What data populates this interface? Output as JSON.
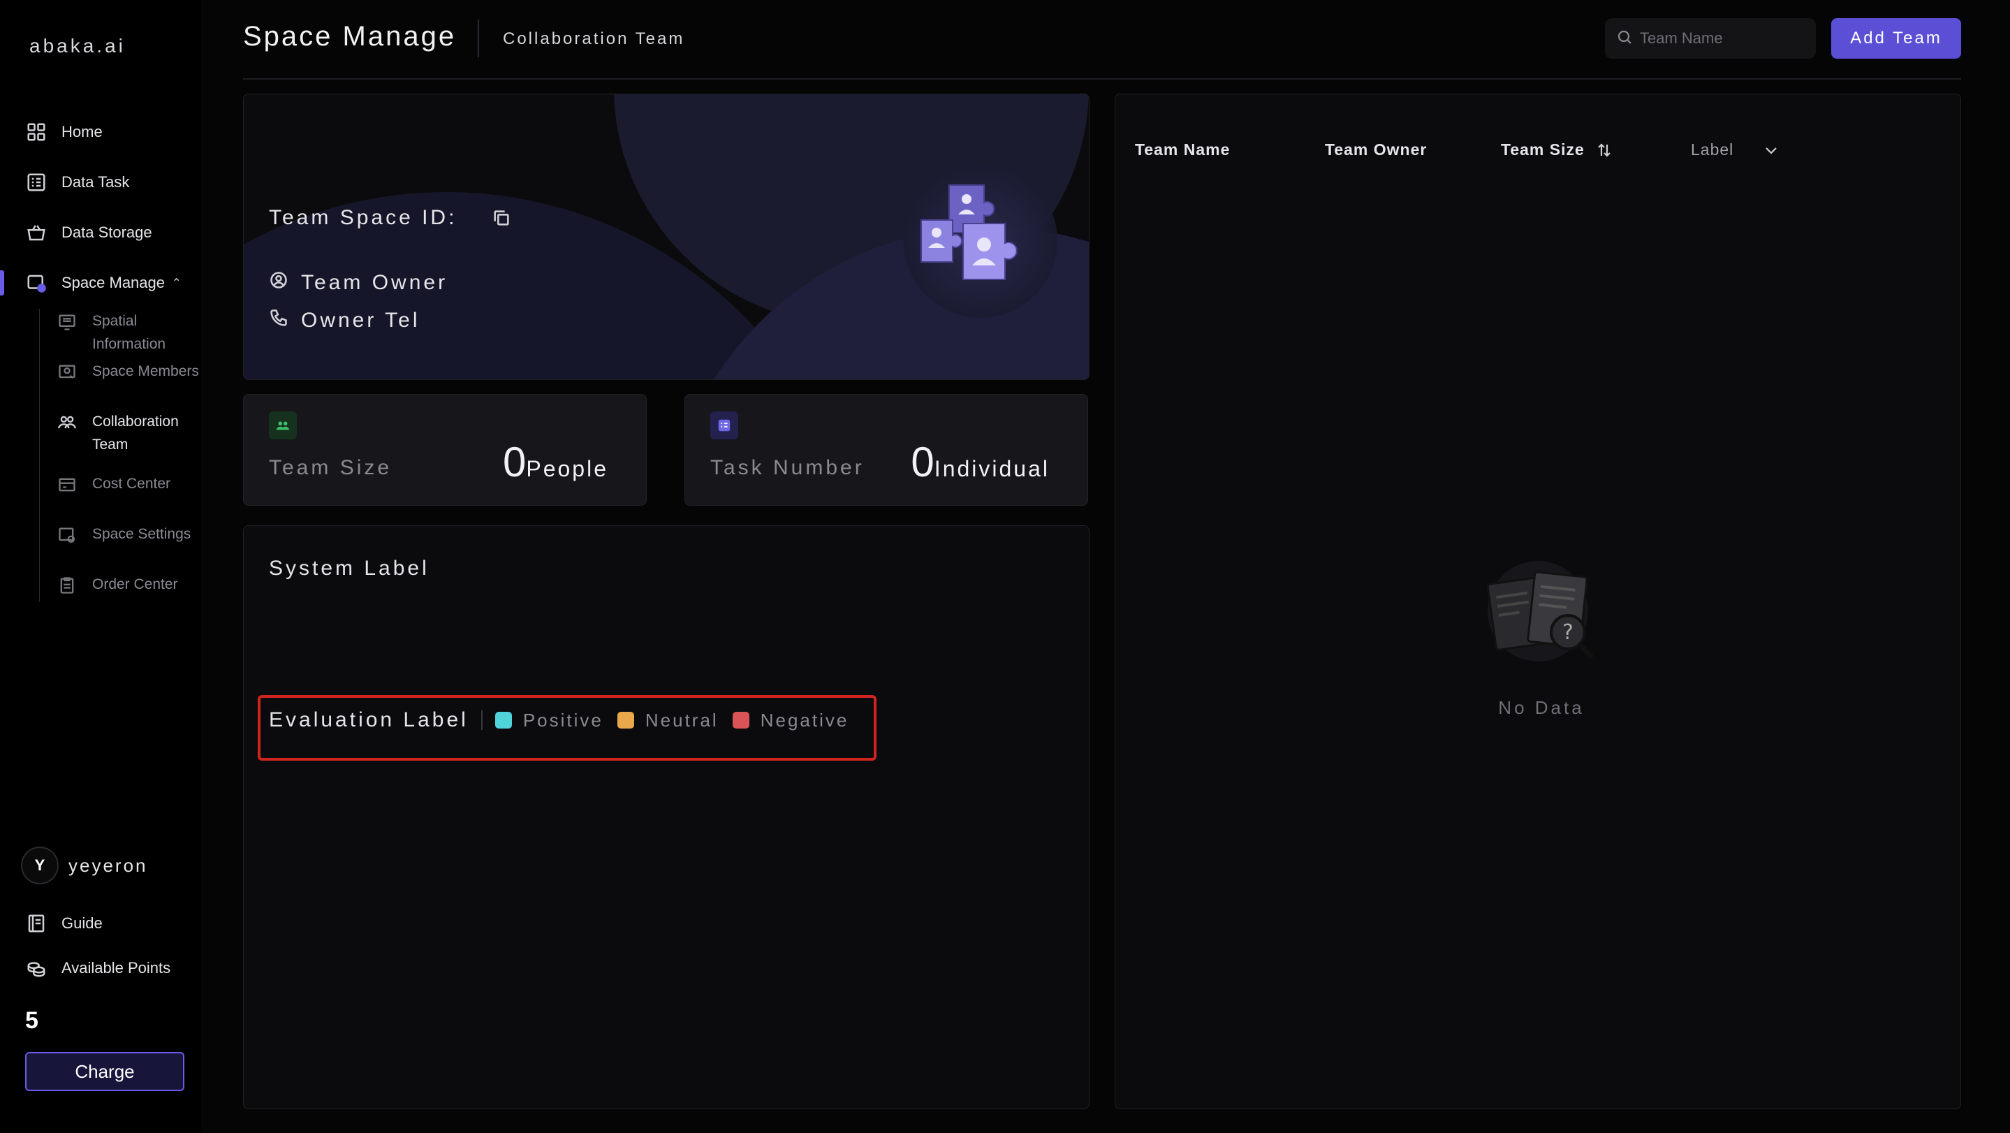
{
  "brand": {
    "logo": "abaka.ai"
  },
  "sidebar": {
    "items": [
      {
        "label": "Home"
      },
      {
        "label": "Data Task"
      },
      {
        "label": "Data Storage"
      },
      {
        "label": "Space Manage"
      }
    ],
    "sub_items": [
      {
        "label": "Spatial Information"
      },
      {
        "label": "Space Members"
      },
      {
        "label": "Collaboration Team"
      },
      {
        "label": "Cost Center"
      },
      {
        "label": "Space Settings"
      },
      {
        "label": "Order Center"
      }
    ],
    "user": {
      "initial": "Y",
      "name": "yeyeron"
    },
    "guide": "Guide",
    "points_label": "Available Points",
    "points_value": "5",
    "charge": "Charge"
  },
  "header": {
    "title": "Space Manage",
    "subtitle": "Collaboration Team",
    "search_placeholder": "Team Name",
    "add_button": "Add Team"
  },
  "space_card": {
    "space_id_label": "Team Space ID:",
    "owner_label": "Team Owner",
    "tel_label": "Owner Tel"
  },
  "stats": {
    "team_size": {
      "label": "Team Size",
      "value": "0",
      "unit": "People",
      "badge_color": "#1f6b3a"
    },
    "task_number": {
      "label": "Task Number",
      "value": "0",
      "unit": "Individual",
      "badge_color": "#4b46b8"
    }
  },
  "labels": {
    "title": "System Label",
    "evaluation": {
      "title": "Evaluation Label",
      "items": [
        {
          "label": "Positive",
          "color": "#4fd3d9"
        },
        {
          "label": "Neutral",
          "color": "#e9a84a"
        },
        {
          "label": "Negative",
          "color": "#d95357"
        }
      ]
    }
  },
  "table": {
    "columns": [
      "Team Name",
      "Team Owner",
      "Team Size",
      "Label"
    ],
    "empty_text": "No Data"
  },
  "colors": {
    "accent": "#5b4fd6",
    "highlight": "#d2241e"
  }
}
